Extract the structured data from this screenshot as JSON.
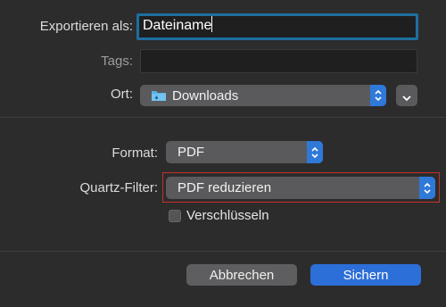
{
  "dialog": {
    "export_label": "Exportieren als:",
    "filename": "Dateiname",
    "tags_label": "Tags:",
    "tags_value": "",
    "location_label": "Ort:",
    "location_value": "Downloads",
    "format_label": "Format:",
    "format_value": "PDF",
    "quartz_label": "Quartz-Filter:",
    "quartz_value": "PDF reduzieren",
    "encrypt_label": "Verschlüsseln",
    "encrypt_checked": false,
    "cancel_label": "Abbrechen",
    "save_label": "Sichern"
  },
  "colors": {
    "focus_ring": "#1e6f9e",
    "stepper_blue": "#2f79d9",
    "primary_button": "#2d6fd8",
    "highlight_red": "#c9302c"
  },
  "icons": {
    "folder": "folder-icon",
    "stepper": "chevron-up-down-icon",
    "expand": "chevron-down-icon"
  }
}
